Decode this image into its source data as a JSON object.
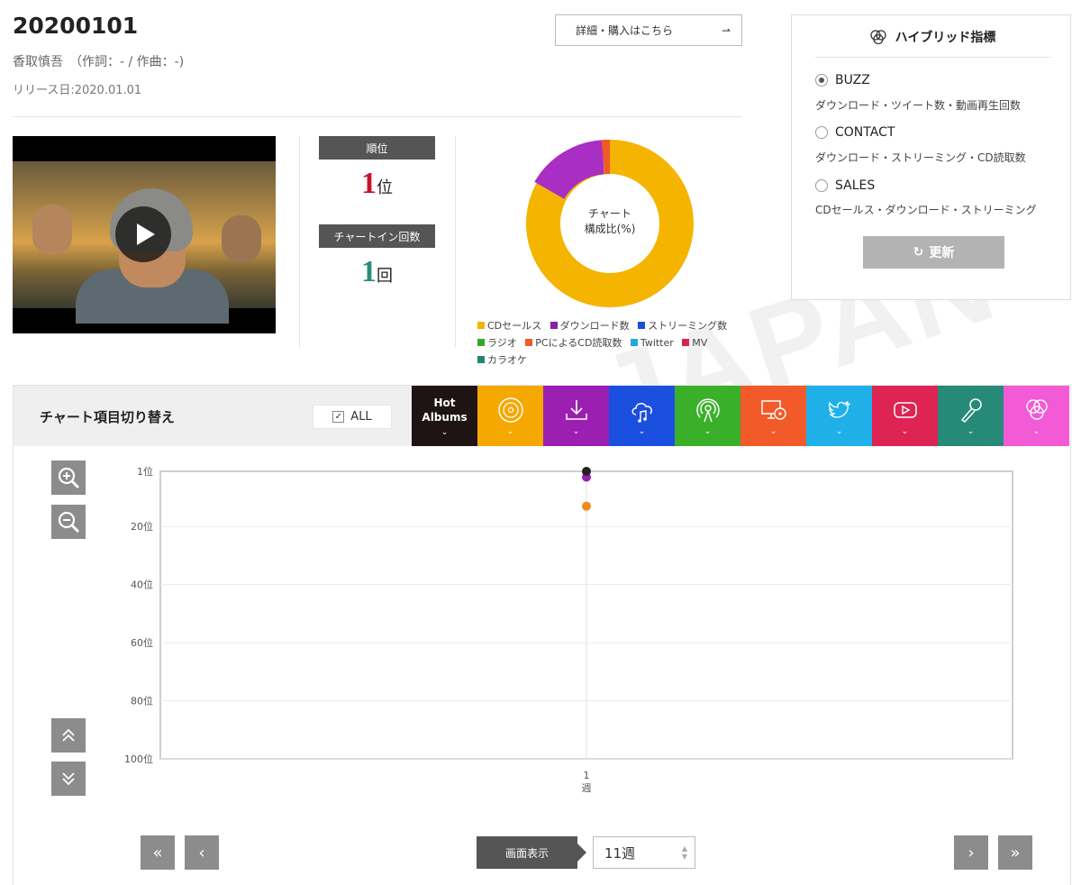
{
  "header": {
    "title": "20200101",
    "artist": "香取慎吾　（作詞：- / 作曲：-)",
    "release": "リリース日:2020.01.01",
    "buy_label": "詳細・購入はこちら",
    "buy_arrow": "⇀"
  },
  "watermark": "JAPAN",
  "rank": {
    "rank_label": "順位",
    "rank_value": "1",
    "rank_unit": "位",
    "chartin_label": "チャートイン回数",
    "chartin_value": "1",
    "chartin_unit": "回"
  },
  "donut": {
    "label_line1": "チャート",
    "label_line2": "構成比(%)",
    "legend": [
      {
        "name": "CDセールス",
        "color": "#f5b400"
      },
      {
        "name": "ダウンロード数",
        "color": "#8b1fa8"
      },
      {
        "name": "ストリーミング数",
        "color": "#1b4fd8"
      },
      {
        "name": "ラジオ",
        "color": "#35a82a"
      },
      {
        "name": "PCによるCD読取数",
        "color": "#f05a28"
      },
      {
        "name": "Twitter",
        "color": "#1ea9e0"
      },
      {
        "name": "MV",
        "color": "#d6234f"
      },
      {
        "name": "カラオケ",
        "color": "#258473"
      }
    ]
  },
  "hybrid": {
    "title": "ハイブリッド指標",
    "options": [
      {
        "name": "BUZZ",
        "desc": "ダウンロード・ツイート数・動画再生回数",
        "selected": true
      },
      {
        "name": "CONTACT",
        "desc": "ダウンロード・ストリーミング・CD読取数",
        "selected": false
      },
      {
        "name": "SALES",
        "desc": "CDセールス・ダウンロード・ストリーミング",
        "selected": false
      }
    ],
    "refresh_label": "更新",
    "refresh_icon": "↻"
  },
  "chart_switch": {
    "title": "チャート項目切り替え",
    "all_label": "ALL",
    "all_check": "✓",
    "hot_line1": "Hot",
    "hot_line2": "Albums",
    "tabs": [
      {
        "icon": "cd-icon",
        "color": "#f5a800"
      },
      {
        "icon": "download-icon",
        "color": "#9b1fb0"
      },
      {
        "icon": "cloud-music-icon",
        "color": "#1b4fe0"
      },
      {
        "icon": "radio-icon",
        "color": "#3ab02a"
      },
      {
        "icon": "pc-cd-icon",
        "color": "#f25a2a"
      },
      {
        "icon": "twitter-icon",
        "color": "#1fb0e8"
      },
      {
        "icon": "youtube-icon",
        "color": "#dd2452"
      },
      {
        "icon": "karaoke-icon",
        "color": "#278a78"
      },
      {
        "icon": "hybrid-icon",
        "color": "#f25ad6"
      }
    ],
    "hot_color": "#1e1414"
  },
  "chart_data": {
    "type": "line",
    "x": [
      "1"
    ],
    "x_unit": "週",
    "y_ticks": [
      "1位",
      "20位",
      "40位",
      "60位",
      "80位",
      "100位"
    ],
    "ylim": [
      1,
      100
    ],
    "y_inverted": true,
    "grid": true,
    "series": [
      {
        "values": [
          1
        ],
        "color": "#222222"
      },
      {
        "values": [
          3
        ],
        "color": "#9b1fb0"
      },
      {
        "values": [
          13
        ],
        "color": "#f08a1a"
      }
    ]
  },
  "pager": {
    "first": "«",
    "prev": "‹",
    "next": "›",
    "last": "»",
    "view_label": "画面表示",
    "weeks_value": "11週",
    "spin_up": "▲",
    "spin_down": "▼"
  }
}
